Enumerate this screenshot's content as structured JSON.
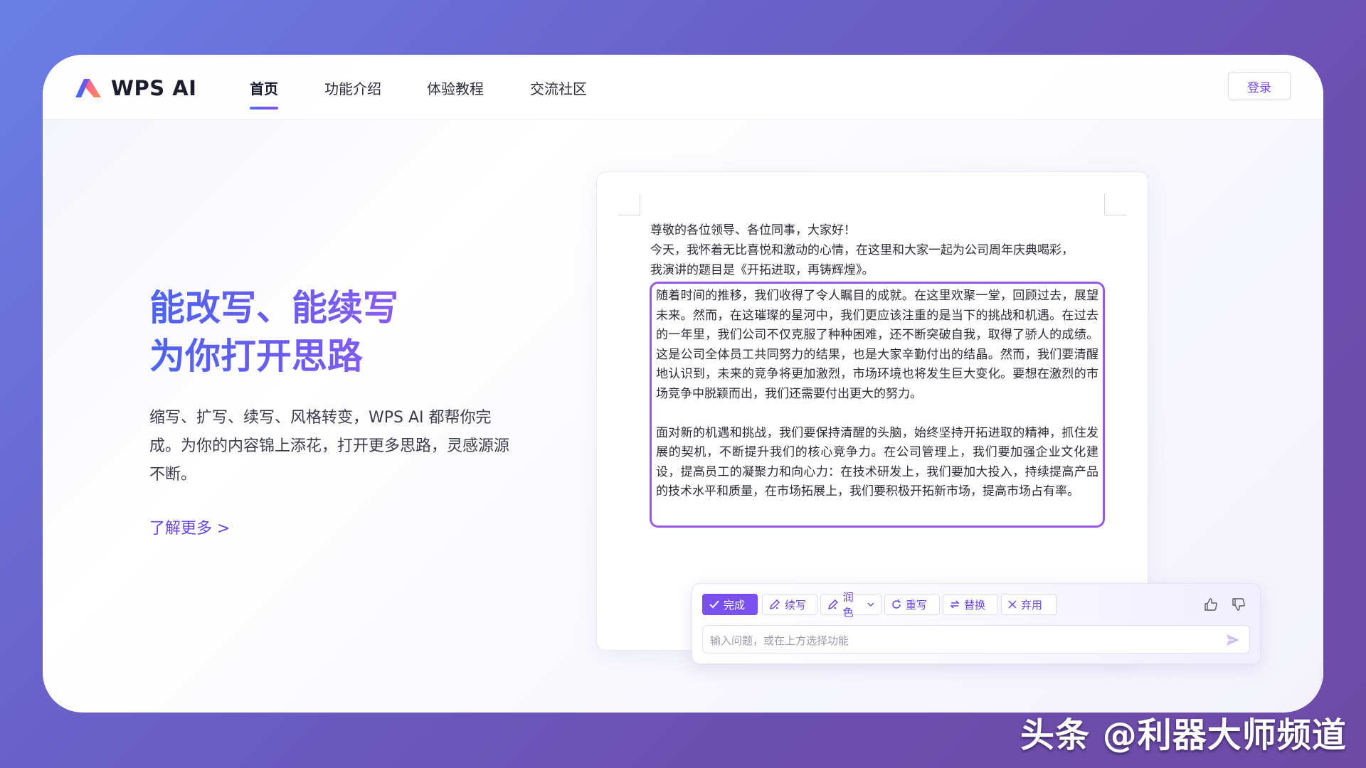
{
  "brand": {
    "name": "WPS AI"
  },
  "nav": {
    "items": [
      {
        "label": "首页",
        "active": true
      },
      {
        "label": "功能介绍",
        "active": false
      },
      {
        "label": "体验教程",
        "active": false
      },
      {
        "label": "交流社区",
        "active": false
      }
    ],
    "login_label": "登录"
  },
  "hero": {
    "title_line1": "能改写、能续写",
    "title_line2": "为你打开思路",
    "description": "缩写、扩写、续写、风格转变，WPS AI 都帮你完成。为你的内容锦上添花，打开更多思路，灵感源源不断。",
    "learn_more": "了解更多 >"
  },
  "document": {
    "intro_lines": [
      "尊敬的各位领导、各位同事，大家好！",
      "今天，我怀着无比喜悦和激动的心情，在这里和大家一起为公司周年庆典喝彩，",
      "我演讲的题目是《开拓进取，再铸辉煌》。"
    ],
    "selected_paragraph_1": "随着时间的推移，我们收得了令人瞩目的成就。在这里欢聚一堂，回顾过去，展望未来。然而，在这璀璨的星河中，我们更应该注重的是当下的挑战和机遇。在过去的一年里，我们公司不仅克服了种种困难，还不断突破自我，取得了骄人的成绩。这是公司全体员工共同努力的结果，也是大家辛勤付出的结晶。然而，我们要清醒地认识到，未来的竞争将更加激烈，市场环境也将发生巨大变化。要想在激烈的市场竞争中脱颖而出，我们还需要付出更大的努力。",
    "selected_paragraph_2": "面对新的机遇和挑战，我们要保持清醒的头脑，始终坚持开拓进取的精神，抓住发展的契机，不断提升我们的核心竞争力。在公司管理上，我们要加强企业文化建设，提高员工的凝聚力和向心力：在技术研发上，我们要加大投入，持续提高产品的技术水平和质量，在市场拓展上，我们要积极开拓新市场，提高市场占有率。"
  },
  "ai_toolbar": {
    "buttons": {
      "done": "完成",
      "continue": "续写",
      "polish": "润色",
      "rewrite": "重写",
      "replace": "替换",
      "discard": "弃用"
    },
    "input_placeholder": "输入问题，或在上方选择功能"
  },
  "watermark": "头条 @利器大师频道",
  "colors": {
    "accent": "#7a4ff0",
    "selection_border": "#9a57e2",
    "link": "#6a46dc",
    "title_gradient_start": "#4d64ee",
    "title_gradient_end": "#8a5cf2"
  }
}
